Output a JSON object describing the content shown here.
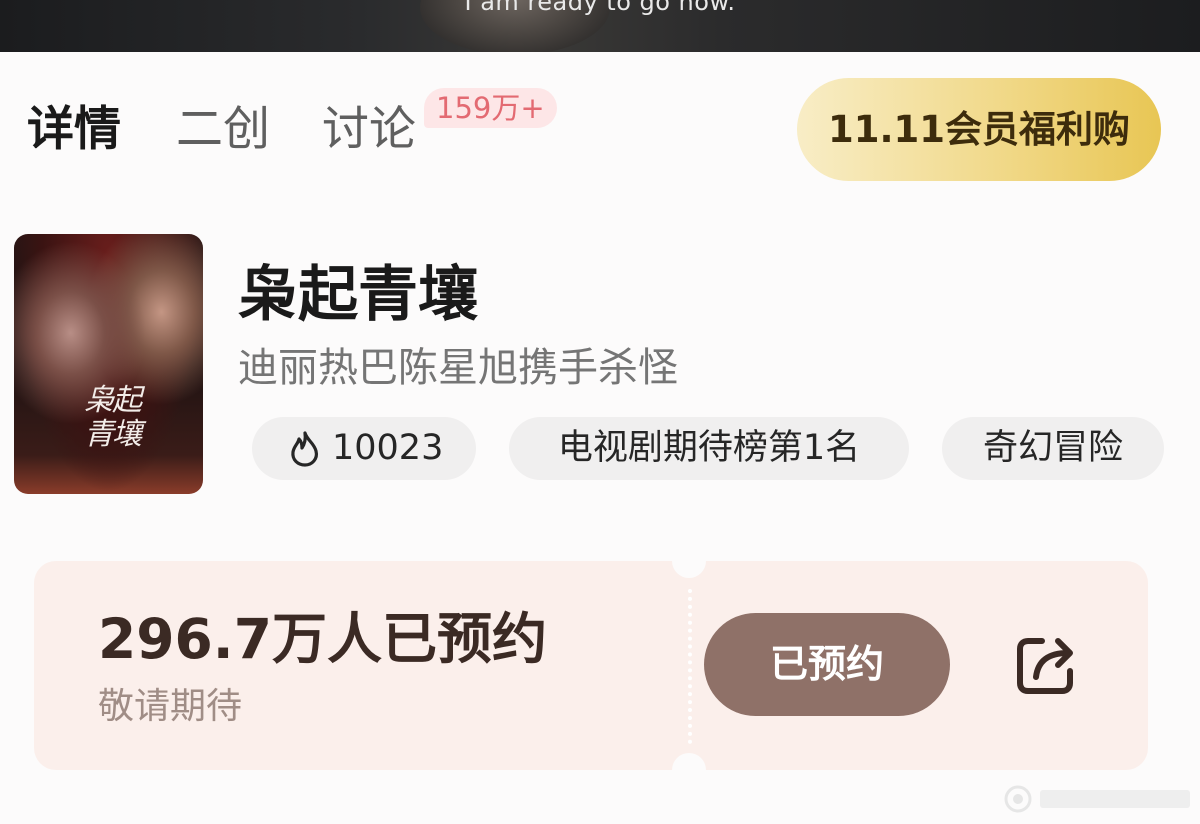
{
  "video": {
    "subtitle": "I am ready to go now."
  },
  "tabs": [
    {
      "label": "详情",
      "active": true
    },
    {
      "label": "二创",
      "active": false
    },
    {
      "label": "讨论",
      "active": false,
      "badge": "159万+"
    }
  ],
  "promo": {
    "label": "11.11会员福利购"
  },
  "poster": {
    "title": "枭起青壤"
  },
  "show": {
    "title": "枭起青壤",
    "subtitle": "迪丽热巴陈星旭携手杀怪",
    "tags": [
      {
        "icon": "flame-icon",
        "label": "10023"
      },
      {
        "label": "电视剧期待榜第1名"
      },
      {
        "label": "奇幻冒险"
      }
    ]
  },
  "reservation": {
    "count_text": "296.7万人已预约",
    "await_text": "敬请期待",
    "button_label": "已预约",
    "share_icon": "share-icon"
  },
  "colors": {
    "active_tab": "#1a1a1a",
    "badge_bg": "#fde6e7",
    "badge_text": "#e36a72",
    "promo_gold": "#e8c654",
    "ticket_bg": "#fbefeb",
    "reserve_button": "#8f7168",
    "count_text": "#3b2a24"
  }
}
